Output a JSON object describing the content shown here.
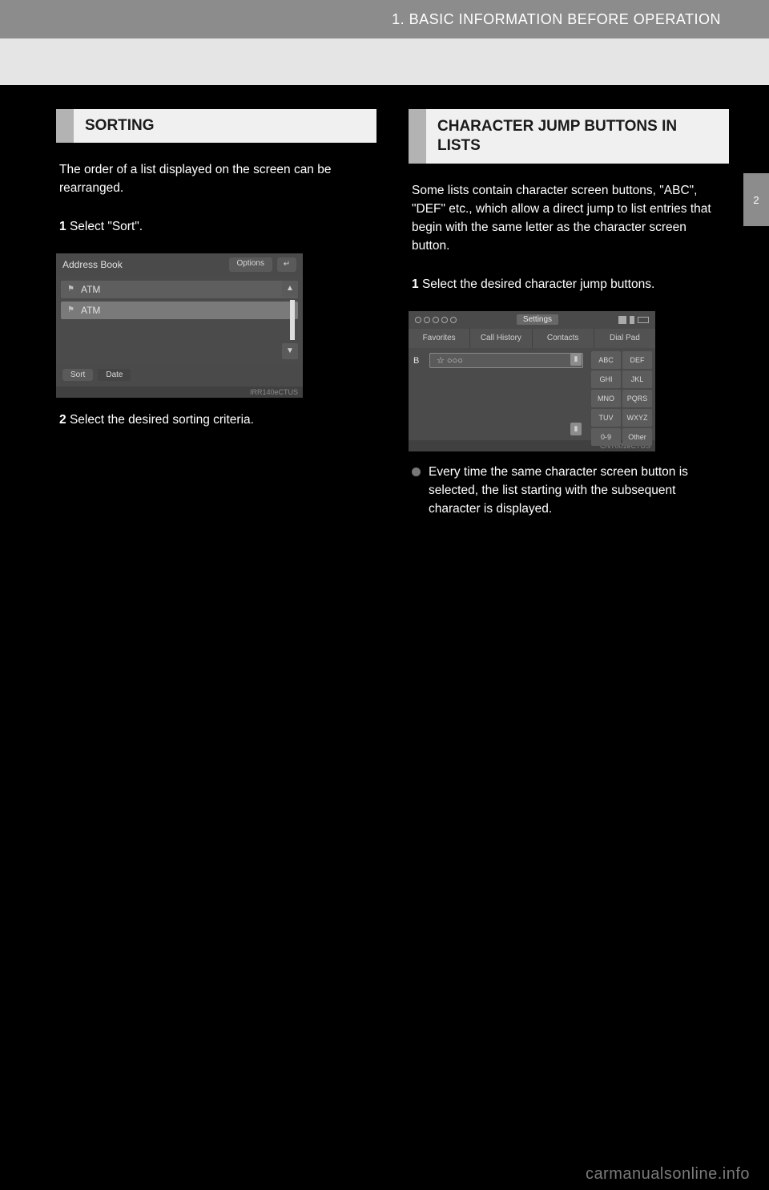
{
  "header": {
    "chapter": "1. BASIC INFORMATION BEFORE OPERATION"
  },
  "side_tab": "2",
  "left": {
    "heading": "SORTING",
    "body1": "The order of a list displayed on the screen can be rearranged.",
    "step1_num": "1",
    "step1_text": "Select \"Sort\".",
    "screenshot": {
      "title": "Address Book",
      "options_btn": "Options",
      "back_btn": "↵",
      "rows": [
        "ATM",
        "ATM"
      ],
      "sort_btn": "Sort",
      "date_btn": "Date",
      "caption_id": "IRR140eCTUS"
    },
    "step2_num": "2",
    "step2_text": "Select the desired sorting criteria."
  },
  "right": {
    "heading": "CHARACTER JUMP BUTTONS IN LISTS",
    "body1": "Some lists contain character screen buttons, \"ABC\", \"DEF\" etc., which allow a direct jump to list entries that begin with the same letter as the character screen button.",
    "step1_num": "1",
    "step1_text": "Select the desired character jump buttons.",
    "screenshot": {
      "settings": "Settings",
      "circles": 5,
      "tabs": [
        "Favorites",
        "Call History",
        "Contacts",
        "Dial Pad"
      ],
      "list_badge": "B",
      "list_item": "☆ ○○○",
      "char_buttons": [
        "ABC",
        "DEF",
        "GHI",
        "JKL",
        "MNO",
        "PQRS",
        "TUV",
        "WXYZ",
        "0-9",
        "Other"
      ],
      "caption_id": "CNT001eCTUS"
    },
    "bullet_text": "Every time the same character screen button is selected, the list starting with the subsequent character is displayed."
  },
  "watermark": "carmanualsonline.info"
}
